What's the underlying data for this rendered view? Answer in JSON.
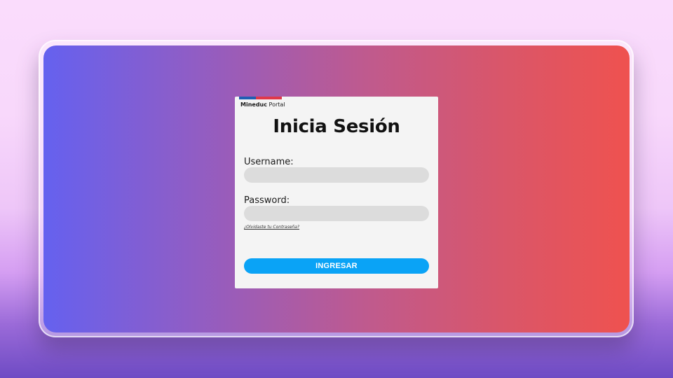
{
  "brand": {
    "name_bold": "Mineduc",
    "name_rest": " Portal",
    "colors": {
      "blue": "#1f5fb3",
      "red": "#e0394a"
    }
  },
  "login": {
    "title": "Inicia Sesión",
    "username_label": "Username:",
    "username_value": "",
    "password_label": "Password:",
    "password_value": "",
    "forgot_link": "¿Olvidaste tu Contraseña?",
    "submit_label": "INGRESAR"
  },
  "colors": {
    "gradient_start": "#6561ef",
    "gradient_end": "#ef524f",
    "button": "#0aa3f6",
    "card": "#f4f4f4",
    "input_bg": "#dcdcdc"
  }
}
